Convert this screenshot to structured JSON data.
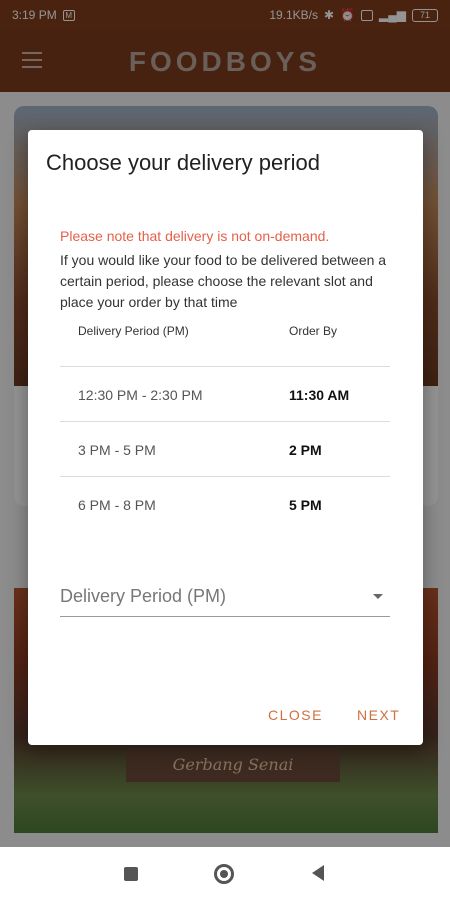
{
  "status_bar": {
    "time": "3:19 PM",
    "speed": "19.1KB/s",
    "battery": "71"
  },
  "app_bar": {
    "brand": "FOODBOYS"
  },
  "background": {
    "sign_text": "Gerbang Senai"
  },
  "dialog": {
    "title": "Choose your delivery period",
    "notice_highlight": "Please note that delivery is not on-demand.",
    "notice_body": "If you would like your food to be delivered between a certain period, please choose the relevant slot and place your order by that time",
    "table": {
      "headers": [
        "Delivery Period (PM)",
        "Order By"
      ],
      "rows": [
        {
          "period": "12:30 PM - 2:30 PM",
          "order_by": "11:30 AM"
        },
        {
          "period": "3 PM - 5 PM",
          "order_by": "2 PM"
        },
        {
          "period": "6 PM - 8 PM",
          "order_by": "5 PM"
        }
      ]
    },
    "select": {
      "placeholder": "Delivery Period (PM)"
    },
    "buttons": {
      "close": "CLOSE",
      "next": "NEXT"
    }
  },
  "colors": {
    "appbar": "#7a3b1c",
    "notice_red": "#e5604a",
    "accent": "#d0703e"
  }
}
